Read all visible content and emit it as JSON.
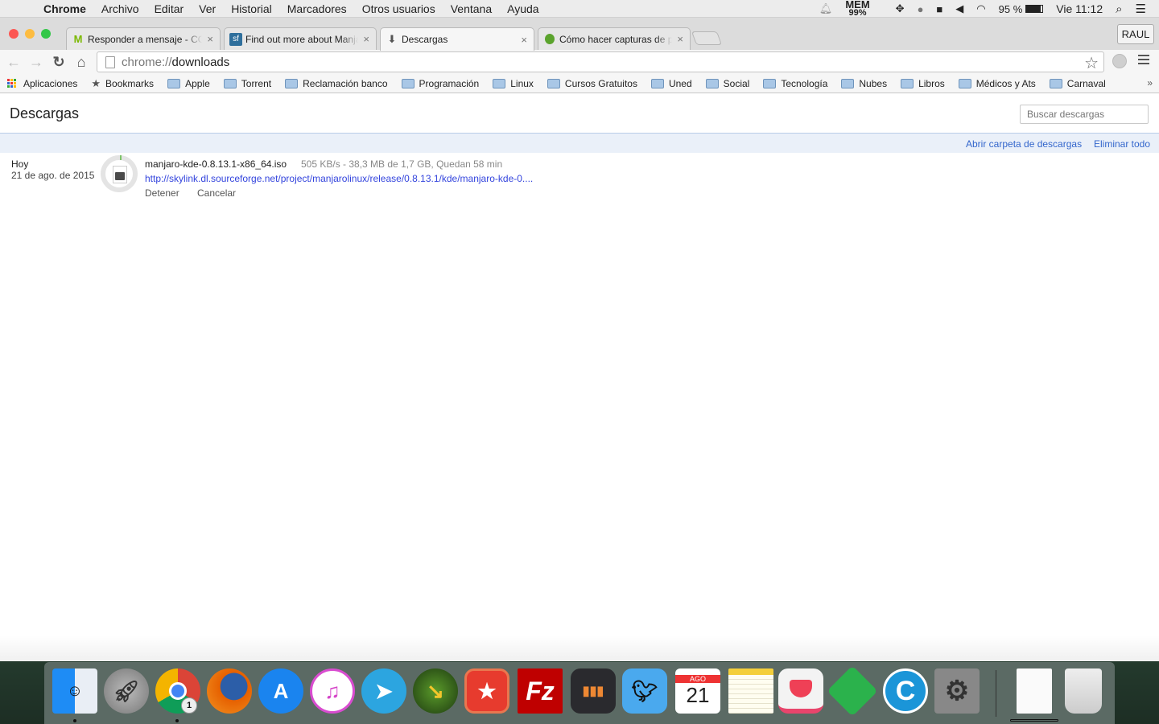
{
  "menubar": {
    "app": "Chrome",
    "items": [
      "Archivo",
      "Editar",
      "Ver",
      "Historial",
      "Marcadores",
      "Otros usuarios",
      "Ventana",
      "Ayuda"
    ],
    "status": {
      "mem_label": "MEM",
      "mem_value": "99%",
      "battery": "95 %",
      "clock": "Vie 11:12"
    }
  },
  "tabs": [
    {
      "title": "Responder a mensaje - CO",
      "icon": "movistar-icon",
      "active": false
    },
    {
      "title": "Find out more about Manja",
      "icon": "sourceforge-icon",
      "active": false
    },
    {
      "title": "Descargas",
      "icon": "download-icon",
      "active": true
    },
    {
      "title": "Cómo hacer capturas de pa",
      "icon": "apple-green-icon",
      "active": false
    }
  ],
  "profile": "RAUL",
  "omnibox": {
    "scheme": "chrome://",
    "host": "downloads"
  },
  "bookmarks": {
    "apps": "Aplicaciones",
    "star": "Bookmarks",
    "folders": [
      "Apple",
      "Torrent",
      "Reclamación banco",
      "Programación",
      "Linux",
      "Cursos Gratuitos",
      "Uned",
      "Social",
      "Tecnología",
      "Nubes",
      "Libros",
      "Médicos y Ats",
      "Carnaval"
    ],
    "more": "»"
  },
  "page": {
    "title": "Descargas",
    "search_placeholder": "Buscar descargas",
    "open_folder": "Abrir carpeta de descargas",
    "clear_all": "Eliminar todo"
  },
  "download": {
    "day": "Hoy",
    "date": "21 de ago. de 2015",
    "filename": "manjaro-kde-0.8.13.1-x86_64.iso",
    "status": "505 KB/s - 38,3 MB de 1,7 GB, Quedan 58 min",
    "progress_fraction": 0.022,
    "url": "http://skylink.dl.sourceforge.net/project/manjarolinux/release/0.8.13.1/kde/manjaro-kde-0....",
    "pause": "Detener",
    "cancel": "Cancelar"
  },
  "dock": {
    "apps": [
      "Finder",
      "Launchpad",
      "Chrome",
      "Firefox",
      "App Store",
      "iTunes",
      "Telegram",
      "JDownloader",
      "Wunderlist",
      "FileZilla",
      "Deezer",
      "Tweetbot",
      "Calendario",
      "Notas",
      "Pocket",
      "Feedly",
      "CCleaner",
      "Preferencias del Sistema",
      "Documento",
      "Papelera"
    ],
    "chrome_badge": "1",
    "calendar_month": "AGO",
    "calendar_day": "21"
  }
}
